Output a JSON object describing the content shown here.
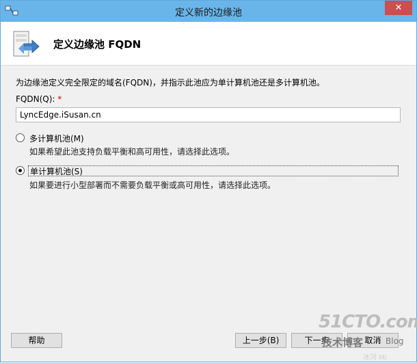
{
  "window": {
    "title": "定义新的边缘池",
    "close_glyph": "✕"
  },
  "header": {
    "title": "定义边缘池 FQDN"
  },
  "description": "为边缘池定义完全限定的域名(FQDN)，并指示此池应为单计算机池还是多计算机池。",
  "fqdn": {
    "label": "FQDN(Q):",
    "required_mark": "*",
    "value": "LyncEdge.iSusan.cn"
  },
  "options": [
    {
      "label": "多计算机池(M)",
      "description": "如果希望此池支持负载平衡和高可用性，请选择此选项。",
      "selected": false
    },
    {
      "label": "单计算机池(S)",
      "description": "如果要进行小型部署而不需要负载平衡或高可用性，请选择此选项。",
      "selected": true
    }
  ],
  "buttons": {
    "help": "帮助",
    "back": "上一步(B)",
    "next": "下一步",
    "cancel": "取消"
  },
  "watermark": {
    "brand": "51CTO.com",
    "subtitle": "技术博客",
    "blog": "Blog",
    "small": "冰河  Mi"
  },
  "colors": {
    "titlebar": "#69b5ea",
    "close": "#c75050",
    "required": "#cc0000"
  }
}
